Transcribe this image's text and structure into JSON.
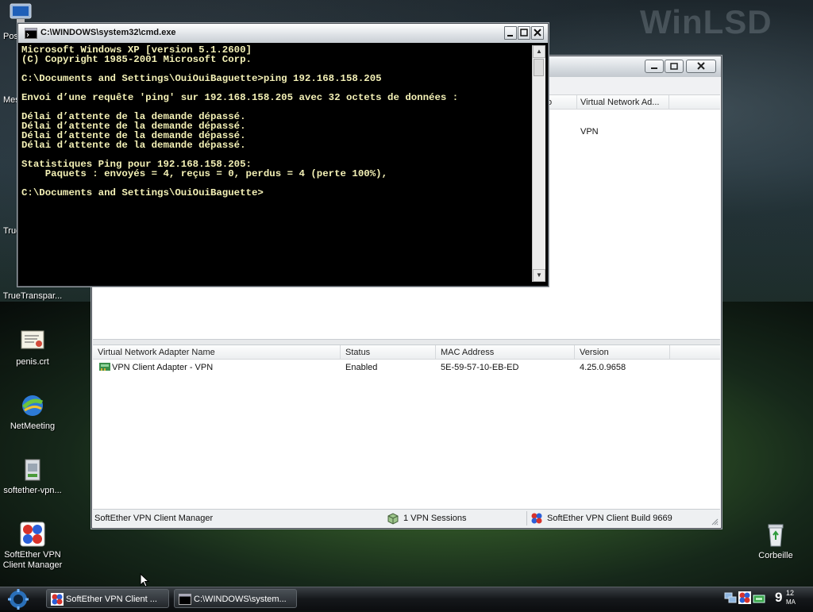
{
  "desktop": {
    "watermark": "WinLSD",
    "icons": [
      {
        "label": "Pos",
        "icon": "computer-icon"
      },
      {
        "label": "Mes",
        "icon": "documents-icon"
      },
      {
        "label": "True",
        "icon": "app-icon"
      },
      {
        "label": "TrueTranspar...",
        "icon": "app-icon"
      },
      {
        "label": "penis.crt",
        "icon": "certificate-icon"
      },
      {
        "label": "NetMeeting",
        "icon": "netmeeting-icon"
      },
      {
        "label": "softether-vpn...",
        "icon": "installer-icon"
      },
      {
        "label": "SoftEther VPN Client Manager",
        "label_line1": "SoftEther VPN",
        "label_line2": "Client Manager",
        "icon": "softether-icon"
      },
      {
        "label": "Corbeille",
        "icon": "recycle-bin-icon"
      }
    ]
  },
  "cmd_window": {
    "title": "C:\\WINDOWS\\system32\\cmd.exe",
    "lines": [
      "Microsoft Windows XP [version 5.1.2600]",
      "(C) Copyright 1985-2001 Microsoft Corp.",
      "",
      "C:\\Documents and Settings\\OuiOuiBaguette>ping 192.168.158.205",
      "",
      "Envoi d’une requête 'ping' sur 192.168.158.205 avec 32 octets de données :",
      "",
      "Délai d’attente de la demande dépassé.",
      "Délai d’attente de la demande dépassé.",
      "Délai d’attente de la demande dépassé.",
      "Délai d’attente de la demande dépassé.",
      "",
      "Statistiques Ping pour 192.168.158.205:",
      "    Paquets : envoyés = 4, reçus = 0, perdus = 4 (perte 100%),",
      "",
      "C:\\Documents and Settings\\OuiOuiBaguette>"
    ]
  },
  "vpn_window": {
    "top_grid": {
      "header_partial": "o",
      "header_adapter": "Virtual Network Ad...",
      "row_adapter_value": "VPN"
    },
    "adapter_grid": {
      "headers": [
        "Virtual Network Adapter Name",
        "Status",
        "MAC Address",
        "Version"
      ],
      "rows": [
        {
          "name": "VPN Client Adapter - VPN",
          "status": "Enabled",
          "mac": "5E-59-57-10-EB-ED",
          "version": "4.25.0.9658"
        }
      ]
    },
    "statusbar": {
      "app": "SoftEther VPN Client Manager",
      "sessions": "1 VPN Sessions",
      "build": "SoftEther VPN Client Build 9669"
    }
  },
  "taskbar": {
    "tasks": [
      {
        "label": "SoftEther VPN Client ...",
        "icon": "softether-icon"
      },
      {
        "label": "C:\\WINDOWS\\system...",
        "icon": "cmd-icon"
      }
    ],
    "clock": {
      "hour": "9",
      "minute": "12",
      "ampm": "MA"
    }
  }
}
